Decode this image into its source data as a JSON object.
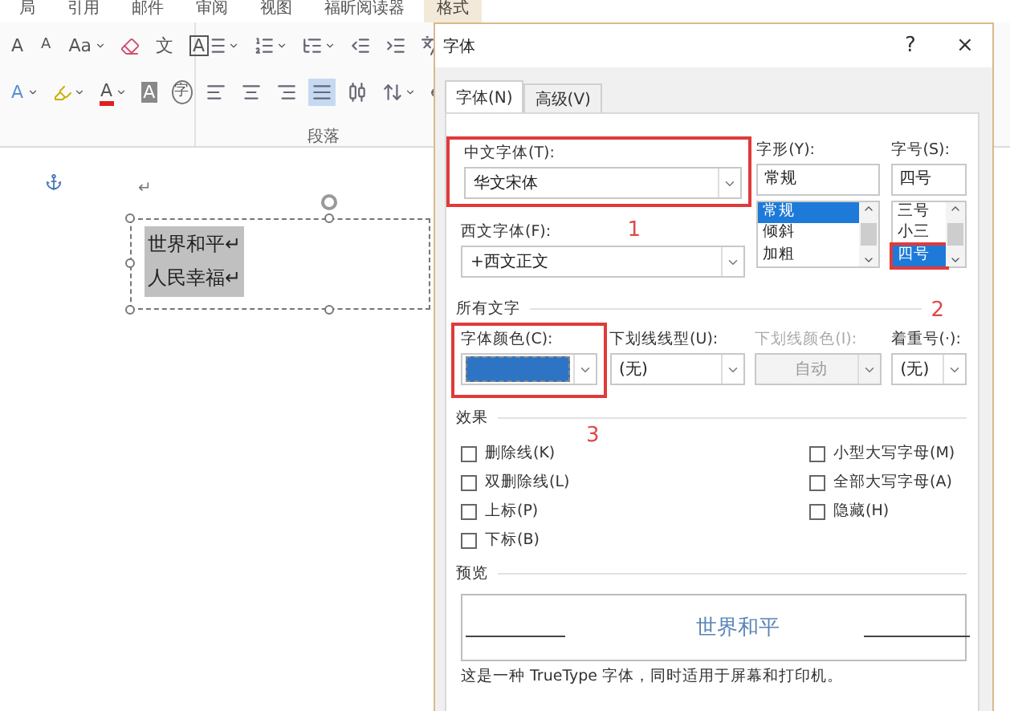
{
  "ribbon": {
    "tabs": [
      {
        "label": "局",
        "selected": false
      },
      {
        "label": "引用",
        "selected": false
      },
      {
        "label": "邮件",
        "selected": false
      },
      {
        "label": "审阅",
        "selected": false
      },
      {
        "label": "视图",
        "selected": false
      },
      {
        "label": "福昕阅读器",
        "selected": false
      },
      {
        "label": "格式",
        "selected": true
      }
    ],
    "font_row1": [
      {
        "kind": "grow",
        "glyph": "A"
      },
      {
        "kind": "shrink",
        "glyph": "A"
      },
      {
        "kind": "case",
        "glyph": "Aa"
      },
      {
        "kind": "clear"
      },
      {
        "kind": "phonetic",
        "glyph": "文"
      },
      {
        "kind": "border",
        "glyph": "A"
      }
    ],
    "font_row2": [
      {
        "kind": "effects",
        "glyph": "A"
      },
      {
        "kind": "highlight"
      },
      {
        "kind": "color",
        "glyph": "A"
      },
      {
        "kind": "shading",
        "glyph": "A"
      },
      {
        "kind": "enclose",
        "glyph": "字"
      }
    ],
    "paragraph_row1": [
      {
        "kind": "bullets"
      },
      {
        "kind": "numbering"
      },
      {
        "kind": "multilevel"
      },
      {
        "kind": "outdent"
      },
      {
        "kind": "indent"
      },
      {
        "kind": "asian"
      }
    ],
    "alignment": [
      {
        "kind": "left",
        "selected": false
      },
      {
        "kind": "center",
        "selected": false
      },
      {
        "kind": "right",
        "selected": false
      },
      {
        "kind": "justify",
        "selected": true
      },
      {
        "kind": "distributed",
        "selected": false
      }
    ],
    "paragraph_row2_extra": [
      {
        "kind": "line_spacing"
      },
      {
        "kind": "fill"
      }
    ],
    "paragraph_group": "段落"
  },
  "document": {
    "paragraph_mark": "↵",
    "text_box_lines": [
      "世界和平↵",
      "人民幸福↵"
    ]
  },
  "dialog": {
    "title": "字体",
    "help": "?",
    "close": "×",
    "tabs": [
      {
        "label": "字体(N)",
        "selected": true
      },
      {
        "label": "高级(V)",
        "selected": false
      }
    ],
    "chinese_font": {
      "label": "中文字体(T):",
      "value": "华文宋体",
      "highlighted": true
    },
    "western_font": {
      "label": "西文字体(F):",
      "value": "+西文正文",
      "highlighted": false
    },
    "style": {
      "label": "字形(Y):",
      "value": "常规",
      "options": [
        {
          "label": "常规",
          "selected": true
        },
        {
          "label": "倾斜",
          "selected": false
        },
        {
          "label": "加粗",
          "selected": false
        }
      ]
    },
    "size": {
      "label": "字号(S):",
      "value": "四号",
      "options": [
        {
          "label": "三号",
          "selected": false,
          "highlighted": false
        },
        {
          "label": "小三",
          "selected": false,
          "highlighted": false
        },
        {
          "label": "四号",
          "selected": true,
          "highlighted": true
        }
      ]
    },
    "annotations": [
      "1",
      "2",
      "3"
    ],
    "all_text": {
      "heading": "所有文字",
      "font_color": {
        "label": "字体颜色(C):",
        "color": "#2e74c4",
        "highlighted": true
      },
      "underline_style": {
        "label": "下划线线型(U):",
        "value": "(无)",
        "disabled": false
      },
      "underline_color": {
        "label": "下划线颜色(I):",
        "value": "自动",
        "disabled": true
      },
      "emphasis": {
        "label": "着重号(·):",
        "value": "(无)",
        "disabled": false
      }
    },
    "effects": {
      "heading": "效果",
      "left": [
        {
          "label": "删除线(K)",
          "checked": false
        },
        {
          "label": "双删除线(L)",
          "checked": false
        },
        {
          "label": "上标(P)",
          "checked": false
        },
        {
          "label": "下标(B)",
          "checked": false
        }
      ],
      "right": [
        {
          "label": "小型大写字母(M)",
          "checked": false
        },
        {
          "label": "全部大写字母(A)",
          "checked": false
        },
        {
          "label": "隐藏(H)",
          "checked": false
        }
      ]
    },
    "preview": {
      "heading": "预览",
      "sample": "世界和平",
      "note": "这是一种 TrueType 字体，同时适用于屏幕和打印机。"
    }
  }
}
